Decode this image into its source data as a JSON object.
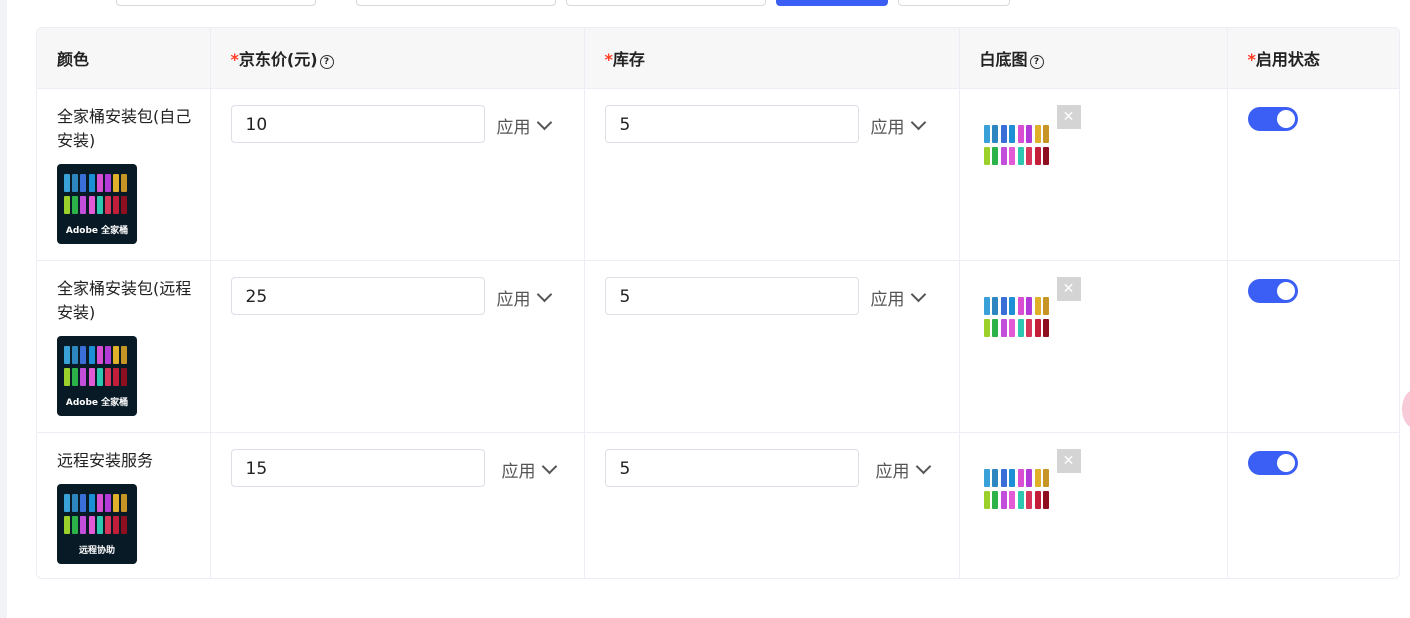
{
  "header": {
    "color": "颜色",
    "price_required": "*",
    "price": "京东价(元)",
    "stock_required": "*",
    "stock": "库存",
    "white_image": "白底图",
    "status_required": "*",
    "status": "启用状态"
  },
  "apply_label": "应用",
  "rows": [
    {
      "name": "全家桶安装包(自己安装)",
      "thumb_caption": "Adobe 全家桶",
      "price": "10",
      "stock": "5",
      "enabled": true
    },
    {
      "name": "全家桶安装包(远程安装)",
      "thumb_caption": "Adobe 全家桶",
      "price": "25",
      "stock": "5",
      "enabled": true
    },
    {
      "name": "远程安装服务",
      "thumb_caption": "远程协助",
      "price": "15",
      "stock": "5",
      "enabled": true
    }
  ],
  "colors": {
    "primary": "#3b5ef4",
    "required": "#ff3b22",
    "header_bg": "#f7f7f7",
    "thumb_bg": "#071a26"
  },
  "icons": {
    "help": "question-circle-icon",
    "chevron": "chevron-down-icon",
    "close": "close-icon"
  }
}
